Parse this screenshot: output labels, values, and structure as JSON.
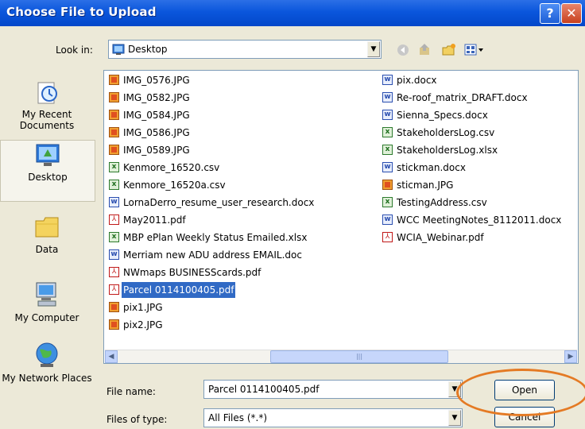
{
  "window": {
    "title": "Choose File to Upload",
    "help_glyph": "?",
    "close_glyph": "✕"
  },
  "lookin": {
    "label": "Look in:",
    "value": "Desktop"
  },
  "toolbar": {
    "icons": [
      "back-icon",
      "up-folder-icon",
      "new-folder-icon",
      "views-menu-icon"
    ]
  },
  "places": [
    {
      "label": "My Recent Documents",
      "icon": "recent-documents-icon"
    },
    {
      "label": "Desktop",
      "icon": "desktop-icon"
    },
    {
      "label": "Data",
      "icon": "folder-icon"
    },
    {
      "label": "My Computer",
      "icon": "my-computer-icon"
    },
    {
      "label": "My Network Places",
      "icon": "network-places-icon"
    }
  ],
  "files": {
    "col1": [
      {
        "name": "IMG_0576.JPG",
        "type": "jpg"
      },
      {
        "name": "IMG_0582.JPG",
        "type": "jpg"
      },
      {
        "name": "IMG_0584.JPG",
        "type": "jpg"
      },
      {
        "name": "IMG_0586.JPG",
        "type": "jpg"
      },
      {
        "name": "IMG_0589.JPG",
        "type": "jpg"
      },
      {
        "name": "Kenmore_16520.csv",
        "type": "csv"
      },
      {
        "name": "Kenmore_16520a.csv",
        "type": "csv"
      },
      {
        "name": "LornaDerro_resume_user_research.docx",
        "type": "doc"
      },
      {
        "name": "May2011.pdf",
        "type": "pdf"
      },
      {
        "name": "MBP ePlan Weekly Status Emailed.xlsx",
        "type": "xls"
      },
      {
        "name": "Merriam new ADU address EMAIL.doc",
        "type": "doc"
      },
      {
        "name": "NWmaps BUSINESScards.pdf",
        "type": "pdf"
      },
      {
        "name": "Parcel 0114100405.pdf",
        "type": "pdf",
        "selected": true
      },
      {
        "name": "pix1.JPG",
        "type": "jpg"
      },
      {
        "name": "pix2.JPG",
        "type": "jpg"
      }
    ],
    "col2": [
      {
        "name": "pix.docx",
        "type": "doc"
      },
      {
        "name": "Re-roof_matrix_DRAFT.docx",
        "type": "doc"
      },
      {
        "name": "Sienna_Specs.docx",
        "type": "doc"
      },
      {
        "name": "StakeholdersLog.csv",
        "type": "csv"
      },
      {
        "name": "StakeholdersLog.xlsx",
        "type": "xls"
      },
      {
        "name": "stickman.docx",
        "type": "doc"
      },
      {
        "name": "sticman.JPG",
        "type": "jpg"
      },
      {
        "name": "TestingAddress.csv",
        "type": "csv"
      },
      {
        "name": "WCC MeetingNotes_8112011.docx",
        "type": "doc"
      },
      {
        "name": "WCIA_Webinar.pdf",
        "type": "pdf"
      }
    ]
  },
  "filename": {
    "label": "File name:",
    "value": "Parcel 0114100405.pdf"
  },
  "filetype": {
    "label": "Files of type:",
    "value": "All Files (*.*)"
  },
  "buttons": {
    "open": "Open",
    "cancel": "Cancel"
  },
  "colors": {
    "titlebar": "#0a56dc",
    "selection": "#316ac5",
    "annotation_ring": "#e47a24"
  }
}
